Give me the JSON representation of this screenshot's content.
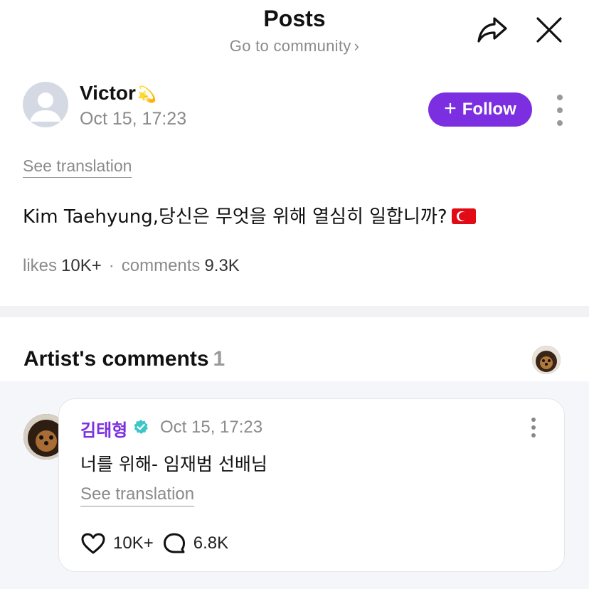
{
  "header": {
    "title": "Posts",
    "subtitle": "Go to community",
    "subtitle_chevron": "›",
    "share_icon": "share-icon",
    "close_icon": "close-icon"
  },
  "post": {
    "author": {
      "name": "Victor",
      "emoji": "💫",
      "date": "Oct 15, 17:23"
    },
    "follow_label": "Follow",
    "follow_plus": "+",
    "see_translation": "See translation",
    "text": "Kim Taehyung,당신은 무엇을 위해 열심히 일합니까?",
    "stats": {
      "likes_label": "likes",
      "likes_value": "10K+",
      "separator": "·",
      "comments_label": "comments",
      "comments_value": "9.3K"
    }
  },
  "artist_comments": {
    "title": "Artist's comments",
    "count": "1",
    "items": [
      {
        "name": "김태형",
        "date": "Oct 15, 17:23",
        "text": "너를 위해- 임재범 선배님",
        "see_translation": "See translation",
        "likes": "10K+",
        "replies": "6.8K"
      }
    ]
  },
  "colors": {
    "accent": "#7b2fe0",
    "verified": "#3cc6c8",
    "muted_text": "#8a8a8a",
    "comments_bg": "#f4f6fa"
  }
}
